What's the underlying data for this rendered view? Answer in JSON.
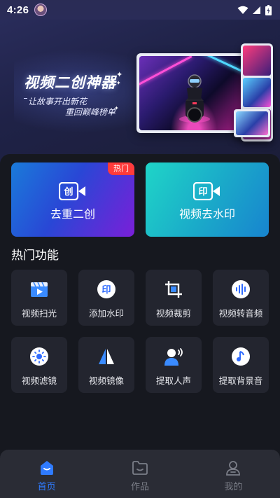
{
  "status_bar": {
    "time": "4:26",
    "icons": [
      "wifi-icon",
      "signal-icon",
      "battery-icon"
    ]
  },
  "hero": {
    "title": "视频二创神器",
    "subtitle_line1": "让故事开出新花",
    "subtitle_line2": "重回巅峰榜单"
  },
  "feature_cards": [
    {
      "label": "去重二创",
      "icon": "create-video-icon",
      "badge": "热门",
      "color_from": "#1a7bd9",
      "color_to": "#7a1fd8"
    },
    {
      "label": "视频去水印",
      "icon": "remove-watermark-icon",
      "color_from": "#1fd5c8",
      "color_to": "#1884cf"
    }
  ],
  "section_title": "热门功能",
  "tools": [
    {
      "label": "视频扫光",
      "icon": "video-scan-icon"
    },
    {
      "label": "添加水印",
      "icon": "add-watermark-icon"
    },
    {
      "label": "视频裁剪",
      "icon": "crop-icon"
    },
    {
      "label": "视频转音频",
      "icon": "audio-wave-icon"
    },
    {
      "label": "视频滤镜",
      "icon": "filter-icon"
    },
    {
      "label": "视频镜像",
      "icon": "mirror-icon"
    },
    {
      "label": "提取人声",
      "icon": "voice-extract-icon"
    },
    {
      "label": "提取背景音",
      "icon": "music-note-icon"
    }
  ],
  "tabbar": {
    "items": [
      {
        "label": "首页",
        "icon": "home-icon",
        "active": true
      },
      {
        "label": "作品",
        "icon": "folder-icon",
        "active": false
      },
      {
        "label": "我的",
        "icon": "profile-icon",
        "active": false
      }
    ],
    "active_color": "#2f7bff"
  }
}
